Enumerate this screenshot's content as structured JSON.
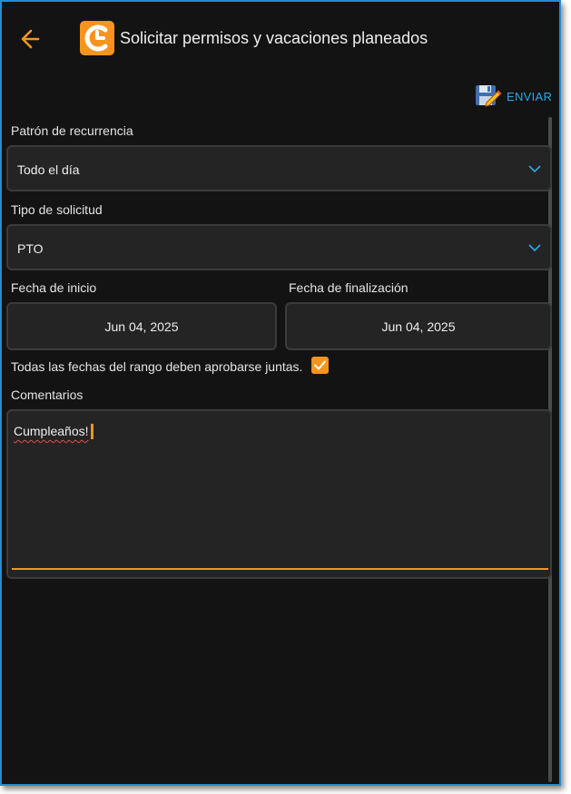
{
  "header": {
    "title": "Solicitar permisos y vacaciones planeados",
    "back_icon": "arrow-left-icon",
    "logo_icon": "app-logo-icon"
  },
  "toolbar": {
    "send_label": "ENVIAR",
    "send_icon": "save-edit-icon"
  },
  "form": {
    "recurrence": {
      "label": "Patrón de recurrencia",
      "value": "Todo el día"
    },
    "request_type": {
      "label": "Tipo de solicitud",
      "value": "PTO"
    },
    "start_date": {
      "label": "Fecha de inicio",
      "value": "Jun 04, 2025"
    },
    "end_date": {
      "label": "Fecha de finalización",
      "value": "Jun 04, 2025"
    },
    "approve_together": {
      "label": "Todas las fechas del rango deben aprobarse juntas.",
      "checked": true
    },
    "comments": {
      "label": "Comentarios",
      "value": "Cumpleaños!"
    }
  },
  "colors": {
    "accent": "#f7941e",
    "link": "#29a9e1",
    "background": "#131313",
    "field": "#242424"
  }
}
